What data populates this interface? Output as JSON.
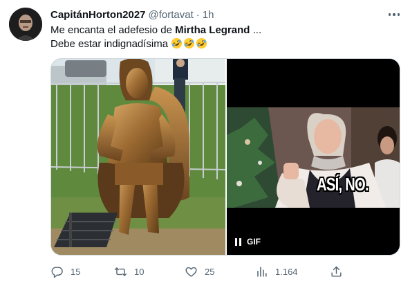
{
  "author": {
    "display_name": "CapitánHorton2027",
    "handle": "@fortavat",
    "separator": "·",
    "time": "1h"
  },
  "tweet": {
    "line1_prefix": "Me encanta el adefesio de ",
    "line1_bold": "Mirtha Legrand",
    "line1_suffix": " ...",
    "line2": "Debe estar indignadísima",
    "emoji": [
      "rolling-on-floor-laughing",
      "rolling-on-floor-laughing",
      "rolling-on-floor-laughing"
    ]
  },
  "media": {
    "gif_caption": "ASÍ, NO.",
    "gif_label": "GIF"
  },
  "actions": {
    "replies": "15",
    "retweets": "10",
    "likes": "25",
    "views": "1.164"
  },
  "colors": {
    "text_primary": "#0f1419",
    "text_secondary": "#536471",
    "border": "#cfd9de"
  }
}
